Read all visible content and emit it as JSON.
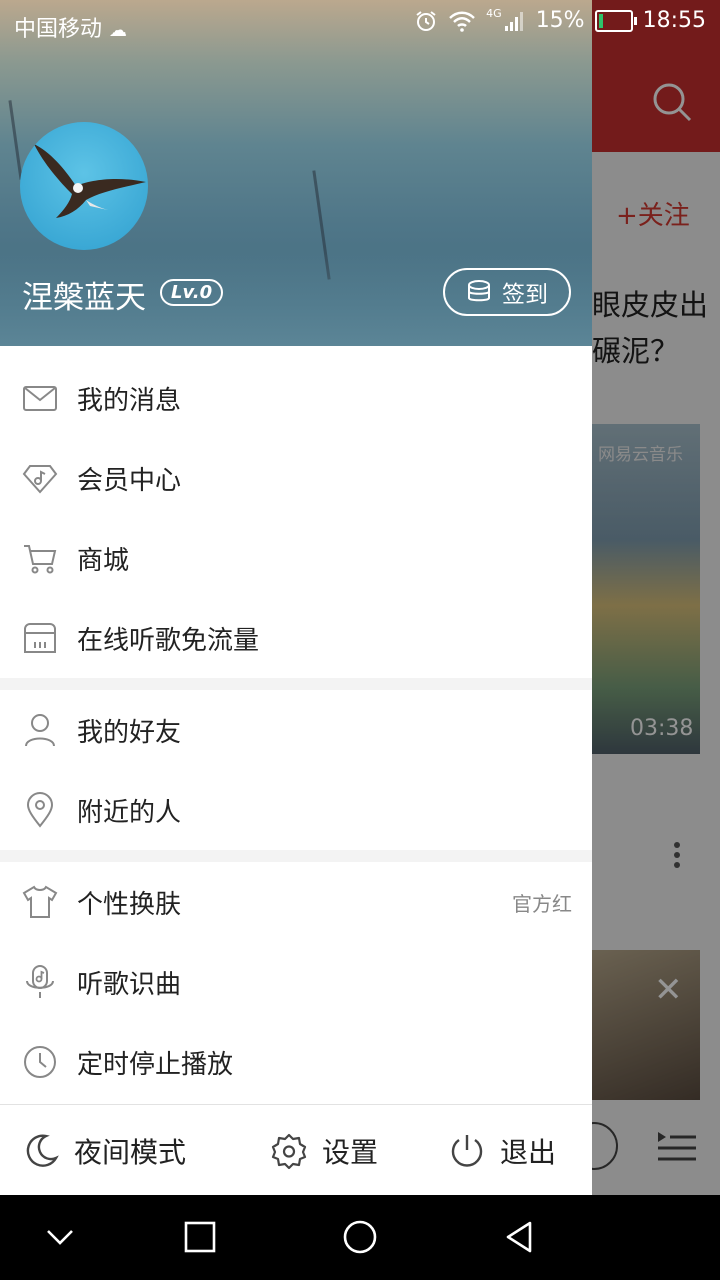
{
  "status_bar": {
    "carrier": "中国移动",
    "battery": "15%",
    "battery_level": 0.15,
    "network": "4G",
    "time": "18:55"
  },
  "profile": {
    "username": "涅槃蓝天",
    "level": "Lv.0",
    "signin_label": "签到"
  },
  "menu_groups": [
    [
      {
        "name": "messages",
        "label": "我的消息",
        "icon": "mail-icon"
      },
      {
        "name": "vip",
        "label": "会员中心",
        "icon": "diamond-music-icon"
      },
      {
        "name": "store",
        "label": "商城",
        "icon": "cart-icon"
      },
      {
        "name": "free-data",
        "label": "在线听歌免流量",
        "icon": "sim-card-icon"
      }
    ],
    [
      {
        "name": "friends",
        "label": "我的好友",
        "icon": "person-icon"
      },
      {
        "name": "nearby",
        "label": "附近的人",
        "icon": "location-pin-icon"
      }
    ],
    [
      {
        "name": "skin",
        "label": "个性换肤",
        "icon": "tshirt-icon",
        "value": "官方红"
      },
      {
        "name": "recognize",
        "label": "听歌识曲",
        "icon": "mic-music-icon"
      },
      {
        "name": "timer",
        "label": "定时停止播放",
        "icon": "clock-icon"
      }
    ]
  ],
  "bottom_bar": {
    "night_mode": "夜间模式",
    "settings": "设置",
    "exit": "退出"
  },
  "background": {
    "follow": "+关注",
    "article_title": "眼皮皮出碾泥？",
    "watermark": "网易云音乐",
    "duration": "03:38"
  },
  "colors": {
    "brand_red": "#c62f2f",
    "text": "#222222",
    "secondary": "#888888"
  }
}
